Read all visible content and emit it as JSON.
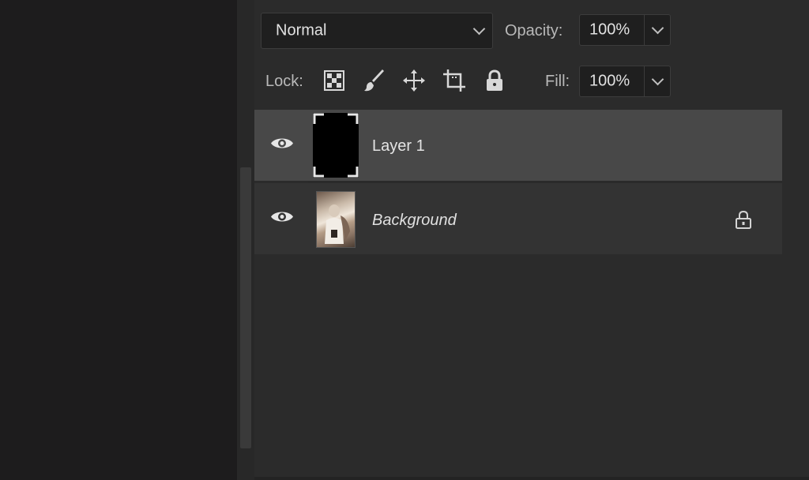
{
  "blend_mode": {
    "value": "Normal"
  },
  "opacity": {
    "label": "Opacity:",
    "value": "100%"
  },
  "lock": {
    "label": "Lock:",
    "icons": [
      "lock-transparent-pixels-icon",
      "lock-image-pixels-icon",
      "lock-position-icon",
      "lock-artboard-icon",
      "lock-all-icon"
    ]
  },
  "fill": {
    "label": "Fill:",
    "value": "100%"
  },
  "layers": [
    {
      "name": "Layer 1",
      "visible": true,
      "selected": true,
      "locked": false,
      "thumbnail": "black-fill"
    },
    {
      "name": "Background",
      "visible": true,
      "selected": false,
      "locked": true,
      "thumbnail": "photo"
    }
  ],
  "colors": {
    "panel_bg": "#2b2b2b",
    "selected_row": "#484848",
    "row_bg": "#333333",
    "field_bg": "#1f1f1f"
  }
}
